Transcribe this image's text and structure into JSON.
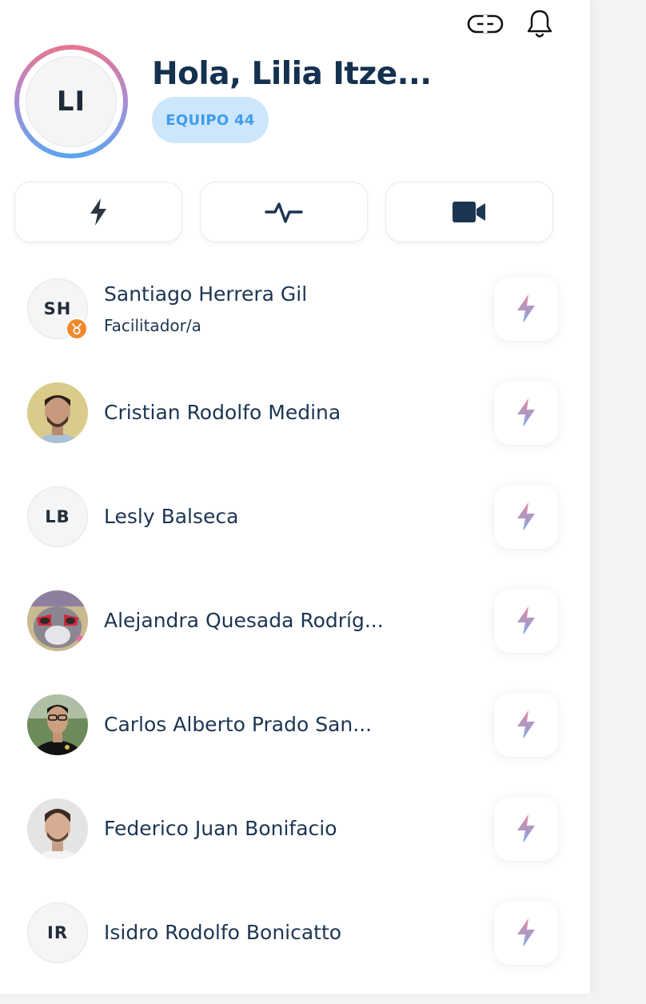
{
  "header": {
    "link_icon": "link-icon",
    "bell_icon": "bell-icon",
    "avatar_initials": "LI",
    "greeting": "Hola, Lilia Itze...",
    "team_badge": "EQUIPO 44"
  },
  "actions": [
    {
      "icon": "lightning-icon"
    },
    {
      "icon": "activity-pulse-icon"
    },
    {
      "icon": "video-camera-icon"
    }
  ],
  "members": [
    {
      "name": "Santiago Herrera Gil",
      "role": "Facilitador/a",
      "initials": "SH",
      "avatar": "initials",
      "badge": "medal-icon"
    },
    {
      "name": "Cristian Rodolfo Medina",
      "avatar": "photo"
    },
    {
      "name": "Lesly Balseca",
      "initials": "LB",
      "avatar": "initials"
    },
    {
      "name": "Alejandra Quesada Rodríg...",
      "avatar": "photo"
    },
    {
      "name": "Carlos Alberto Prado San...",
      "avatar": "photo"
    },
    {
      "name": "Federico Juan Bonifacio",
      "avatar": "photo"
    },
    {
      "name": "Isidro Rodolfo Bonicatto",
      "initials": "IR",
      "avatar": "initials"
    }
  ],
  "colors": {
    "text": "#1c3553",
    "badge_bg": "#cce6fb",
    "badge_text": "#3f9cec",
    "ring_top": "#e8768e",
    "ring_bottom": "#5aa6ef",
    "medal": "#ef8a2c"
  }
}
